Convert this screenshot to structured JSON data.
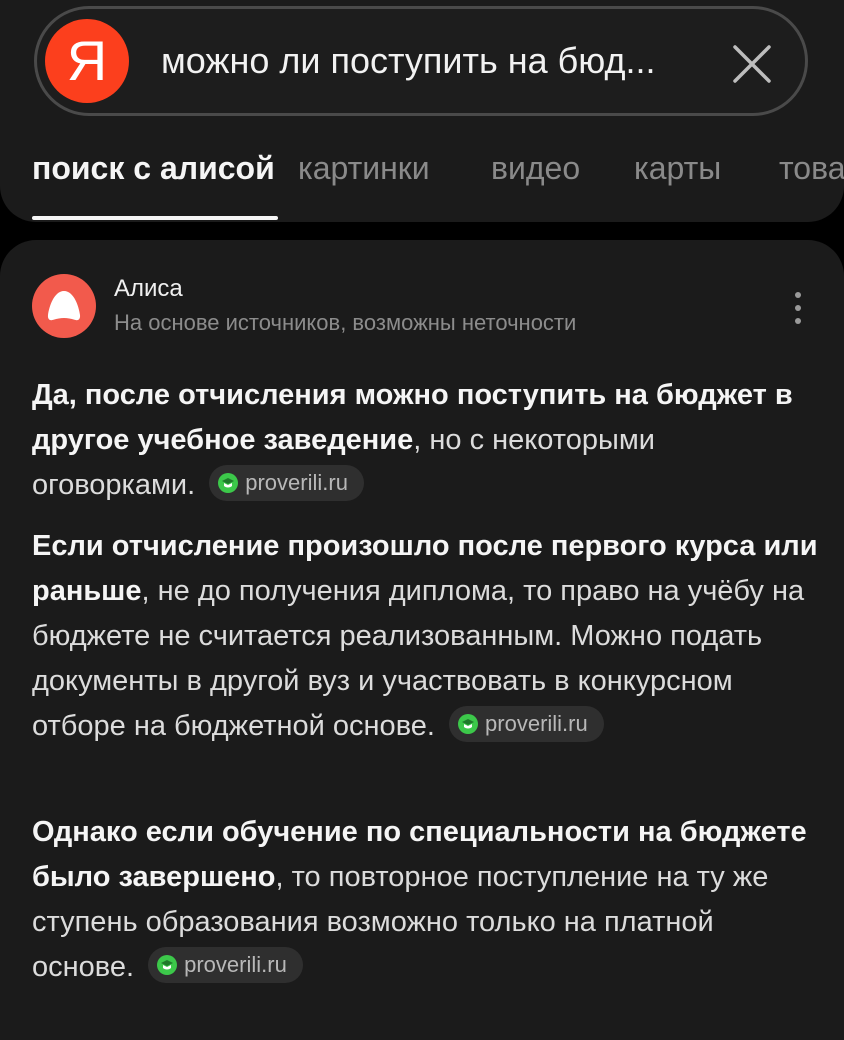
{
  "search": {
    "logo_letter": "Я",
    "query": "можно ли поступить на бюд..."
  },
  "tabs": [
    {
      "label": "поиск с алисой"
    },
    {
      "label": "картинки"
    },
    {
      "label": "видео"
    },
    {
      "label": "карты"
    },
    {
      "label": "това"
    }
  ],
  "answer": {
    "author": "Алиса",
    "disclaimer": "На основе источников, возможны неточности",
    "paragraphs": [
      {
        "bold": "Да, после отчисления можно поступить на бюджет в другое учебное заведение",
        "text": ", но с некоторыми оговорками.",
        "source": "proverili.ru"
      },
      {
        "bold": "Если отчисление произошло после первого курса или раньше",
        "text": ", не до получения диплома, то право на учёбу на бюджете не считается реализованным. Можно подать документы в другой вуз и участвовать в конкурсном отборе на бюджетной основе.",
        "source": "proverili.ru"
      },
      {
        "bold": "Однако если обучение по специальности на бюджете было завершено",
        "text": ", то повторное поступление на ту же ступень образования возможно только на платной основе.",
        "source": "proverili.ru"
      }
    ]
  },
  "colors": {
    "brand_red": "#fc3f1d",
    "alice_red": "#f25a4c",
    "source_green": "#3cc84a"
  }
}
